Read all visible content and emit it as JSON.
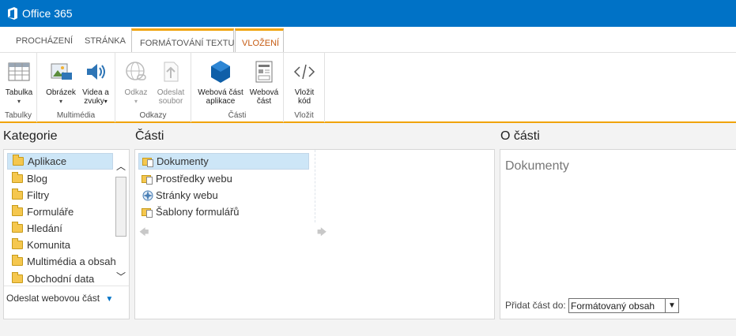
{
  "topbar": {
    "brand": "Office 365",
    "logo_icon": "office-logo-icon"
  },
  "tabs": [
    {
      "label": "PROCHÁZENÍ"
    },
    {
      "label": "STRÁNKA"
    },
    {
      "label": "FORMÁTOVÁNÍ TEXTU"
    },
    {
      "label": "VLOŽENÍ"
    }
  ],
  "ribbon": {
    "groups": [
      {
        "label": "Tabulky",
        "buttons": [
          {
            "label": "Tabulka",
            "icon": "table-icon"
          }
        ]
      },
      {
        "label": "Multimédia",
        "buttons": [
          {
            "label": "Obrázek",
            "icon": "picture-icon"
          },
          {
            "label": "Videa a zvuky",
            "label_line1": "Videa a",
            "label_line2": "zvuky",
            "icon": "media-icon"
          }
        ]
      },
      {
        "label": "Odkazy",
        "buttons": [
          {
            "label": "Odkaz",
            "icon": "link-icon"
          },
          {
            "label": "Odeslat soubor",
            "label_line1": "Odeslat",
            "label_line2": "soubor",
            "icon": "upload-icon"
          }
        ]
      },
      {
        "label": "Části",
        "buttons": [
          {
            "label": "Webová část aplikace",
            "label_line1": "Webová část",
            "label_line2": "aplikace",
            "icon": "app-part-icon"
          },
          {
            "label": "Webová část",
            "label_line1": "Webová",
            "label_line2": "část",
            "icon": "web-part-icon"
          }
        ]
      },
      {
        "label": "Vložit",
        "buttons": [
          {
            "label": "Vložit kód",
            "label_line1": "Vložit",
            "label_line2": "kód",
            "icon": "embed-code-icon"
          }
        ]
      }
    ]
  },
  "categories": {
    "title": "Kategorie",
    "items": [
      {
        "label": "Aplikace"
      },
      {
        "label": "Blog"
      },
      {
        "label": "Filtry"
      },
      {
        "label": "Formuláře"
      },
      {
        "label": "Hledání"
      },
      {
        "label": "Komunita"
      },
      {
        "label": "Multimédia a obsah"
      },
      {
        "label": "Obchodní data"
      }
    ],
    "footer_link": "Odeslat webovou část"
  },
  "parts": {
    "title": "Části",
    "items": [
      {
        "label": "Dokumenty",
        "icon": "document-library-icon"
      },
      {
        "label": "Prostředky webu",
        "icon": "document-library-icon"
      },
      {
        "label": "Stránky webu",
        "icon": "site-pages-icon"
      },
      {
        "label": "Šablony formulářů",
        "icon": "document-library-icon"
      }
    ]
  },
  "about": {
    "title": "O části",
    "part_name": "Dokumenty",
    "add_to_label": "Přidat část do:",
    "add_to_value": "Formátovaný obsah"
  }
}
